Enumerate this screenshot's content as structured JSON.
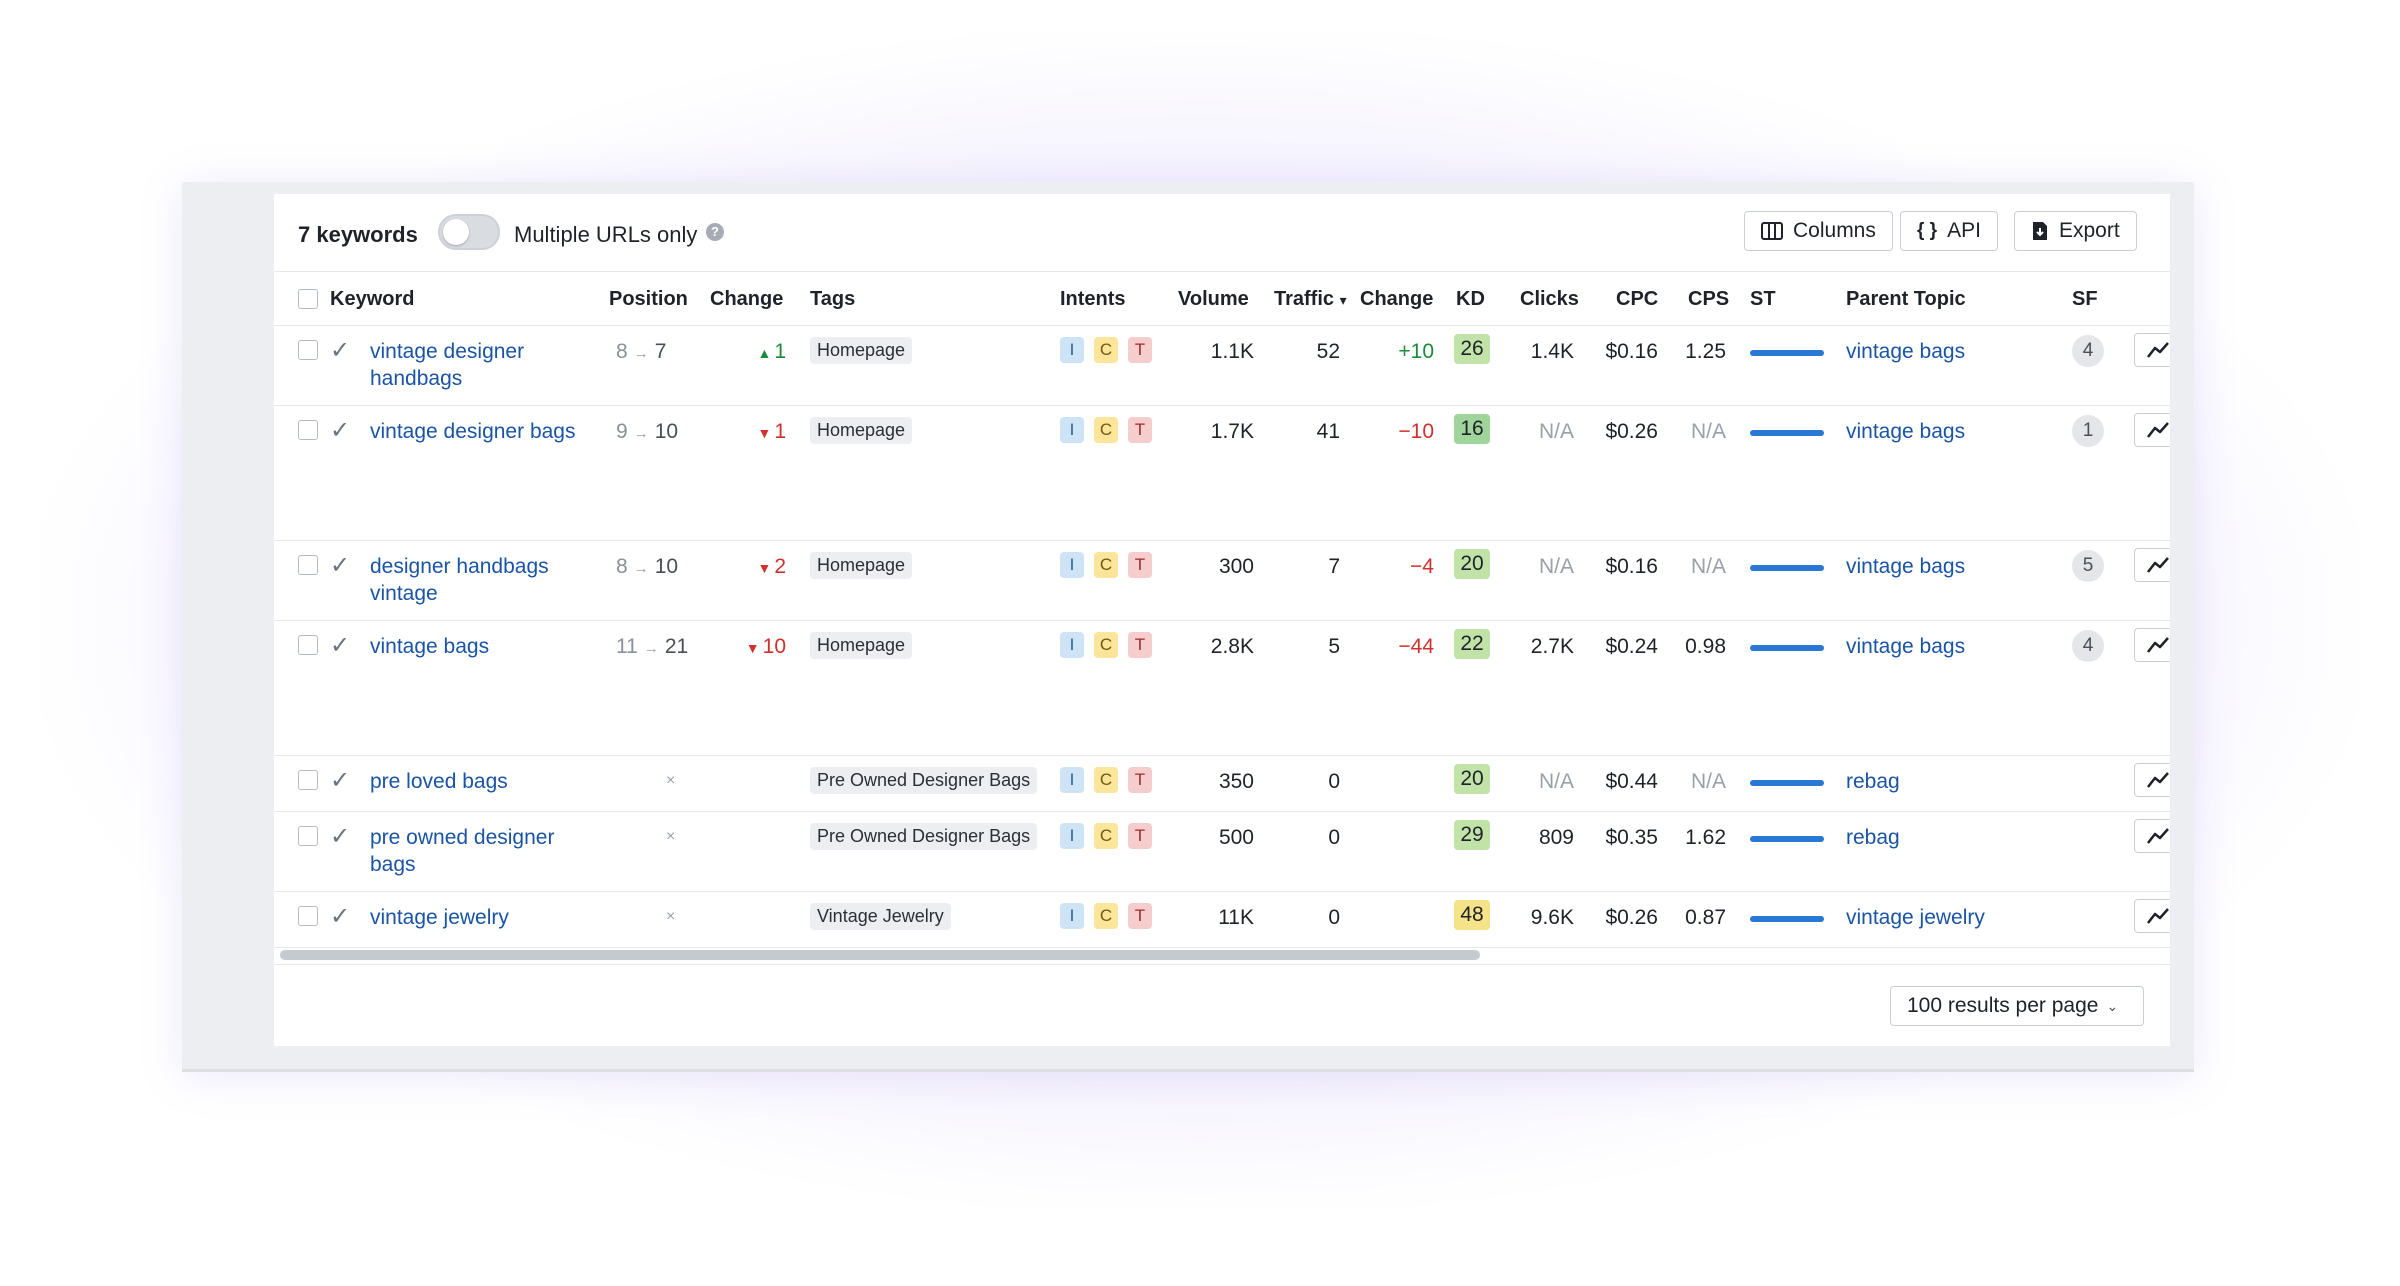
{
  "toolbar": {
    "keyword_count": "7 keywords",
    "multiple_urls_label": "Multiple URLs only",
    "help": "?",
    "columns_label": "Columns",
    "api_label": "API",
    "export_label": "Export"
  },
  "columns": {
    "keyword": "Keyword",
    "position": "Position",
    "change": "Change",
    "tags": "Tags",
    "intents": "Intents",
    "volume": "Volume",
    "traffic": "Traffic",
    "traffic_sort": "▾",
    "traffic_change": "Change",
    "kd": "KD",
    "clicks": "Clicks",
    "cpc": "CPC",
    "cps": "CPS",
    "st": "ST",
    "parent_topic": "Parent Topic",
    "sf": "SF"
  },
  "intent_labels": {
    "i": "I",
    "c": "C",
    "t": "T"
  },
  "rows": [
    {
      "keyword": "vintage designer handbags",
      "pos_from": "8",
      "pos_to": "7",
      "pos_arrow": "→",
      "change": "1",
      "change_dir": "up",
      "change_symbol": "▲",
      "tag": "Homepage",
      "volume": "1.1K",
      "traffic": "52",
      "traffic_change": "+10",
      "kd": "26",
      "kd_color": "#c2e3a7",
      "clicks": "1.4K",
      "cpc": "$0.16",
      "cps": "1.25",
      "parent_topic": "vintage bags",
      "sf": "4"
    },
    {
      "keyword": "vintage designer bags",
      "pos_from": "9",
      "pos_to": "10",
      "pos_arrow": "→",
      "change": "1",
      "change_dir": "down",
      "change_symbol": "▼",
      "tag": "Homepage",
      "volume": "1.7K",
      "traffic": "41",
      "traffic_change": "−10",
      "kd": "16",
      "kd_color": "#9fd49a",
      "clicks": "N/A",
      "cpc": "$0.26",
      "cps": "N/A",
      "parent_topic": "vintage bags",
      "sf": "1"
    },
    {
      "keyword": "designer handbags vintage",
      "pos_from": "8",
      "pos_to": "10",
      "pos_arrow": "→",
      "change": "2",
      "change_dir": "down",
      "change_symbol": "▼",
      "tag": "Homepage",
      "volume": "300",
      "traffic": "7",
      "traffic_change": "−4",
      "kd": "20",
      "kd_color": "#c2e3a7",
      "clicks": "N/A",
      "cpc": "$0.16",
      "cps": "N/A",
      "parent_topic": "vintage bags",
      "sf": "5"
    },
    {
      "keyword": "vintage bags",
      "pos_from": "11",
      "pos_to": "21",
      "pos_arrow": "→",
      "change": "10",
      "change_dir": "down",
      "change_symbol": "▼",
      "tag": "Homepage",
      "volume": "2.8K",
      "traffic": "5",
      "traffic_change": "−44",
      "kd": "22",
      "kd_color": "#c2e3a7",
      "clicks": "2.7K",
      "cpc": "$0.24",
      "cps": "0.98",
      "parent_topic": "vintage bags",
      "sf": "4"
    },
    {
      "keyword": "pre loved bags",
      "pos_none": "×",
      "tag": "Pre Owned Designer Bags",
      "volume": "350",
      "traffic": "0",
      "kd": "20",
      "kd_color": "#c2e3a7",
      "clicks": "N/A",
      "cpc": "$0.44",
      "cps": "N/A",
      "parent_topic": "rebag"
    },
    {
      "keyword": "pre owned designer bags",
      "pos_none": "×",
      "tag": "Pre Owned Designer Bags",
      "volume": "500",
      "traffic": "0",
      "kd": "29",
      "kd_color": "#c2e3a7",
      "clicks": "809",
      "cpc": "$0.35",
      "cps": "1.62",
      "parent_topic": "rebag"
    },
    {
      "keyword": "vintage jewelry",
      "pos_none": "×",
      "tag": "Vintage Jewelry",
      "volume": "11K",
      "traffic": "0",
      "kd": "48",
      "kd_color": "#f5e38a",
      "clicks": "9.6K",
      "cpc": "$0.26",
      "cps": "0.87",
      "parent_topic": "vintage jewelry"
    }
  ],
  "footer": {
    "per_page_label": "100 results per page",
    "chevron": "⌄"
  }
}
